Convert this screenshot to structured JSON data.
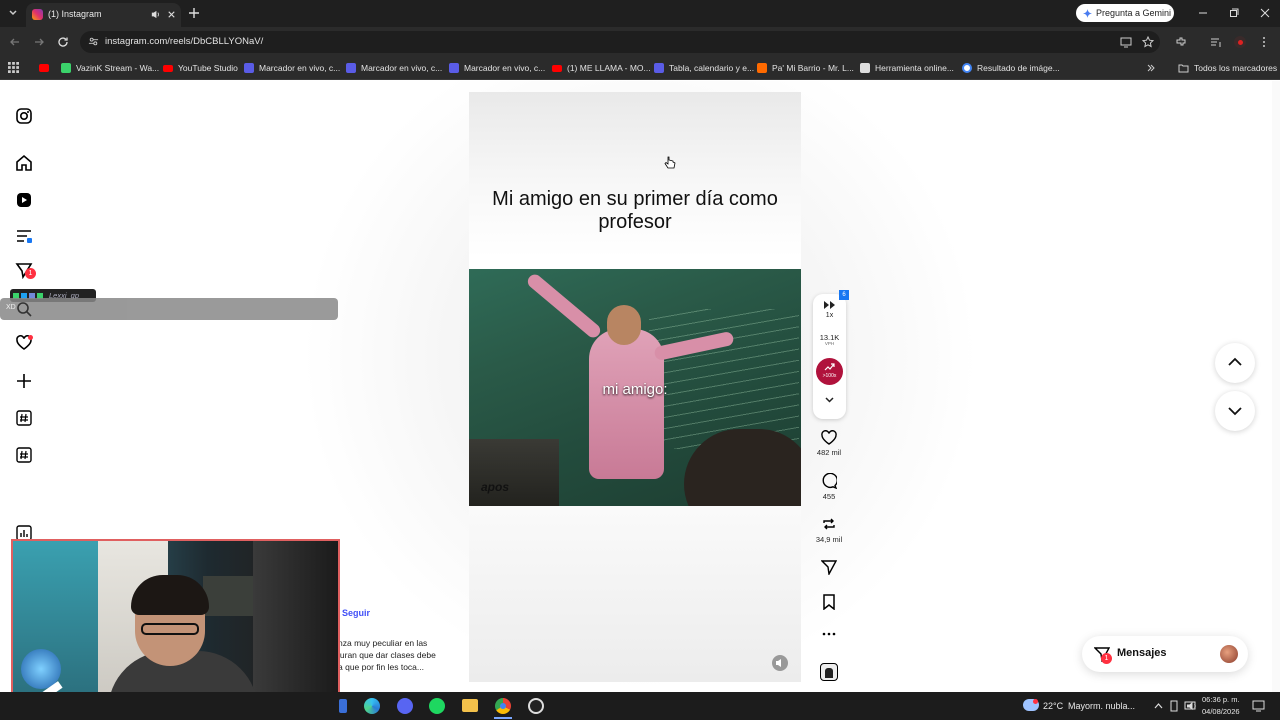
{
  "browser": {
    "tab_title": "(1) Instagram",
    "url": "instagram.com/reels/DbCBLLYONaV/",
    "gemini_button": "Pregunta a Gemini",
    "bookmarks": [
      {
        "label": "VazinK Stream - Wa...",
        "color": "#3bd36b"
      },
      {
        "label": "YouTube Studio",
        "color": "#ff0000"
      },
      {
        "label": "Marcador en vivo, c...",
        "color": "#5a5ce6"
      },
      {
        "label": "Marcador en vivo, c...",
        "color": "#5a5ce6"
      },
      {
        "label": "Marcador en vivo, c...",
        "color": "#5a5ce6"
      },
      {
        "label": "(1) ME LLAMA - MO...",
        "color": "#ff0000"
      },
      {
        "label": "Tabla, calendario y e...",
        "color": "#5a5ce6"
      },
      {
        "label": "Pa' Mi Barrio - Mr. L...",
        "color": "#ff6a00"
      },
      {
        "label": "Herramienta online...",
        "color": "#dddddd"
      },
      {
        "label": "Resultado de imáge...",
        "color": "#ffffff"
      }
    ],
    "all_bookmarks": "Todos los marcadores"
  },
  "sidebar": {
    "notifications_badge": "1",
    "overlay_user": "Lexxi_gp",
    "overlay_prefix": "XD"
  },
  "reel": {
    "title": "Mi amigo en su primer día como profesor",
    "video_caption": "mi amigo:",
    "watermark": "apos",
    "follow_label": "Seguir",
    "description_lines": [
      "nza muy peculiar en las",
      "juran que dar clases debe",
      "a que por fin les toca..."
    ]
  },
  "extension_panel": {
    "speed": "1x",
    "vph_value": "13.1K",
    "vph_label": "VPH",
    "multiplier": ">100x",
    "badge": "6"
  },
  "actions": {
    "likes": "482 mil",
    "comments": "455",
    "reposts": "34,9 mil"
  },
  "messages": {
    "label": "Mensajes",
    "badge": "1"
  },
  "taskbar": {
    "temperature": "22°C",
    "weather": "Mayorm. nubla...",
    "time": "06:36 p. m.",
    "date": "04/08/2026"
  },
  "colors": {
    "accent_red": "#ff3040",
    "ext_magenta": "#b0123c",
    "link_blue": "#4150f7"
  }
}
